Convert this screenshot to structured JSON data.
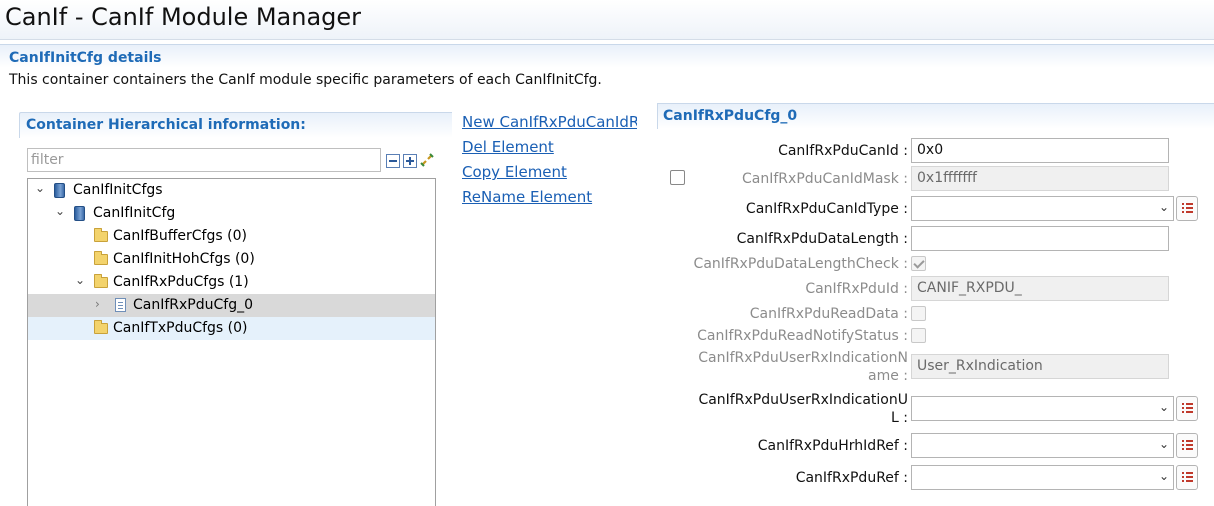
{
  "window": {
    "title": "CanIf - CanIf Module Manager"
  },
  "details": {
    "title": "CanIfInitCfg details",
    "description": "This container containers the CanIf module specific parameters of each CanIfInitCfg."
  },
  "tree_panel": {
    "title": "Container Hierarchical information:",
    "filter_placeholder": "filter",
    "nodes": [
      {
        "label": "CanIfInitCfgs",
        "icon": "database-icon",
        "state": "expanded"
      },
      {
        "label": "CanIfInitCfg",
        "icon": "database-icon",
        "state": "expanded"
      },
      {
        "label": "CanIfBufferCfgs (0)",
        "icon": "folder-icon"
      },
      {
        "label": "CanIfInitHohCfgs (0)",
        "icon": "folder-icon"
      },
      {
        "label": "CanIfRxPduCfgs (1)",
        "icon": "folder-icon",
        "state": "expanded"
      },
      {
        "label": "CanIfRxPduCfg_0",
        "icon": "file-icon",
        "state": "collapsed",
        "selected": true
      },
      {
        "label": "CanIfTxPduCfgs (0)",
        "icon": "folder-icon",
        "highlighted": true
      }
    ]
  },
  "actions": {
    "new": "New CanIfRxPduCanIdRa",
    "delete": "Del Element",
    "copy": "Copy Element",
    "rename": "ReName Element"
  },
  "form": {
    "title": "CanIfRxPduCfg_0",
    "fields": {
      "can_id": {
        "label": "CanIfRxPduCanId :",
        "value": "0x0"
      },
      "can_id_mask": {
        "label": "CanIfRxPduCanIdMask :",
        "value": "0x1fffffff",
        "enabled": false,
        "checked": false
      },
      "can_id_type": {
        "label": "CanIfRxPduCanIdType :",
        "value": ""
      },
      "data_length": {
        "label": "CanIfRxPduDataLength :",
        "value": ""
      },
      "data_length_check": {
        "label": "CanIfRxPduDataLengthCheck :",
        "checked": true,
        "enabled": false
      },
      "pdu_id": {
        "label": "CanIfRxPduId :",
        "value": "CANIF_RXPDU_",
        "enabled": false
      },
      "read_data": {
        "label": "CanIfRxPduReadData :",
        "checked": false,
        "enabled": false
      },
      "read_notify_status": {
        "label": "CanIfRxPduReadNotifyStatus :",
        "checked": false,
        "enabled": false
      },
      "user_rx_indication_name": {
        "label_line1": "CanIfRxPduUserRxIndicationN",
        "label_line2": "ame :",
        "value": "User_RxIndication",
        "enabled": false
      },
      "user_rx_indication_ul": {
        "label_line1": "CanIfRxPduUserRxIndicationU",
        "label_line2": "L :",
        "value": ""
      },
      "hrh_id_ref": {
        "label": "CanIfRxPduHrhIdRef :",
        "value": ""
      },
      "pdu_ref": {
        "label": "CanIfRxPduRef :",
        "value": ""
      }
    }
  },
  "colors": {
    "accent": "#1f6bb7",
    "link": "#1a5fb4",
    "selected_row": "#d9d9d9",
    "hover_row": "#e5f1fb"
  }
}
